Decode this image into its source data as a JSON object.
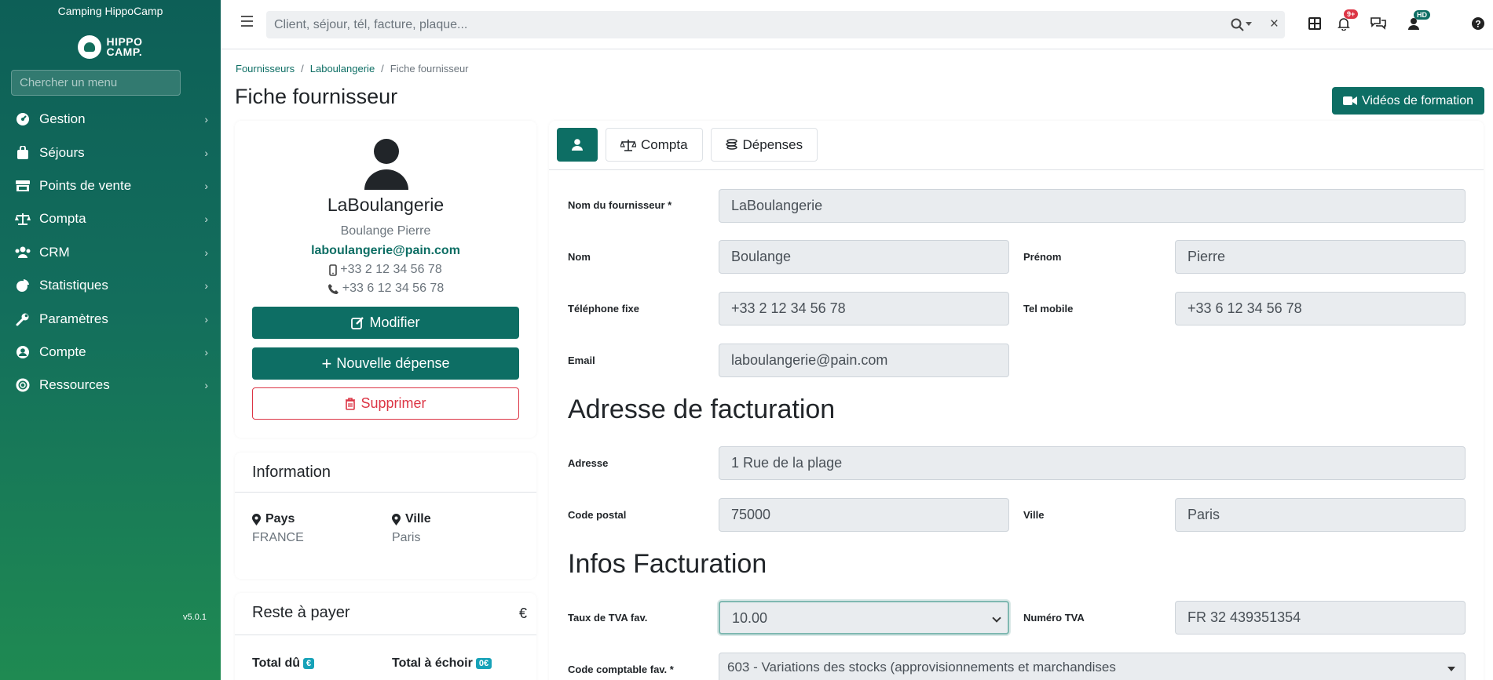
{
  "app": {
    "camp_name": "Camping HippoCamp",
    "logo_line1": "HIPPO",
    "logo_line2": "CAMP.",
    "version": "v5.0.1"
  },
  "sidebar": {
    "search_placeholder": "Chercher un menu",
    "items": [
      {
        "label": "Gestion",
        "icon": "dashboard-icon"
      },
      {
        "label": "Séjours",
        "icon": "bag-icon"
      },
      {
        "label": "Points de vente",
        "icon": "store-icon"
      },
      {
        "label": "Compta",
        "icon": "scale-icon"
      },
      {
        "label": "CRM",
        "icon": "users-icon"
      },
      {
        "label": "Statistiques",
        "icon": "pie-chart-icon"
      },
      {
        "label": "Paramètres",
        "icon": "wrench-icon"
      },
      {
        "label": "Compte",
        "icon": "user-circle-icon"
      },
      {
        "label": "Ressources",
        "icon": "lifebuoy-icon"
      }
    ]
  },
  "topbar": {
    "search_placeholder": "Client, séjour, tél, facture, plaque...",
    "notifications_badge": "9+",
    "user_initials": "HD"
  },
  "breadcrumb": {
    "items": [
      "Fournisseurs",
      "Laboulangerie"
    ],
    "current": "Fiche fournisseur"
  },
  "page": {
    "title": "Fiche fournisseur",
    "video_button": "Vidéos de formation"
  },
  "profile": {
    "supplier_name": "LaBoulangerie",
    "contact_name": "Boulange Pierre",
    "email": "laboulangerie@pain.com",
    "phone_fixed": "+33 2 12 34 56 78",
    "phone_mobile": "+33 6 12 34 56 78",
    "edit_button": "Modifier",
    "new_expense_button": "Nouvelle dépense",
    "delete_button": "Supprimer"
  },
  "information": {
    "title": "Information",
    "country_label": "Pays",
    "country_value": "FRANCE",
    "city_label": "Ville",
    "city_value": "Paris"
  },
  "payment": {
    "title": "Reste à payer",
    "currency": "€",
    "total_due_label": "Total dû",
    "total_due_value": "€",
    "total_pending_label": "Total à échoir",
    "total_pending_value": "0€"
  },
  "tabs": {
    "compta": "Compta",
    "depenses": "Dépenses"
  },
  "form": {
    "supplier_name_label": "Nom du fournisseur *",
    "supplier_name_value": "LaBoulangerie",
    "last_name_label": "Nom",
    "last_name_value": "Boulange",
    "first_name_label": "Prénom",
    "first_name_value": "Pierre",
    "phone_label": "Téléphone fixe",
    "phone_value": "+33 2 12 34 56 78",
    "mobile_label": "Tel mobile",
    "mobile_value": "+33 6 12 34 56 78",
    "email_label": "Email",
    "email_value": "laboulangerie@pain.com",
    "billing_address_title": "Adresse de facturation",
    "address_label": "Adresse",
    "address_value": "1 Rue de la plage",
    "zip_label": "Code postal",
    "zip_value": "75000",
    "city_label": "Ville",
    "city_value": "Paris",
    "billing_info_title": "Infos Facturation",
    "vat_rate_label": "Taux de TVA fav.",
    "vat_rate_value": "10.00",
    "vat_number_label": "Numéro TVA",
    "vat_number_value": "FR 32 439351354",
    "account_code_label": "Code comptable fav. *",
    "account_code_value": "603 - Variations des stocks (approvisionnements et marchandises"
  },
  "colors": {
    "primary": "#0d6e64",
    "danger": "#dc3545",
    "sidebar_top": "#0d5f57",
    "sidebar_bottom": "#1f8a52"
  }
}
